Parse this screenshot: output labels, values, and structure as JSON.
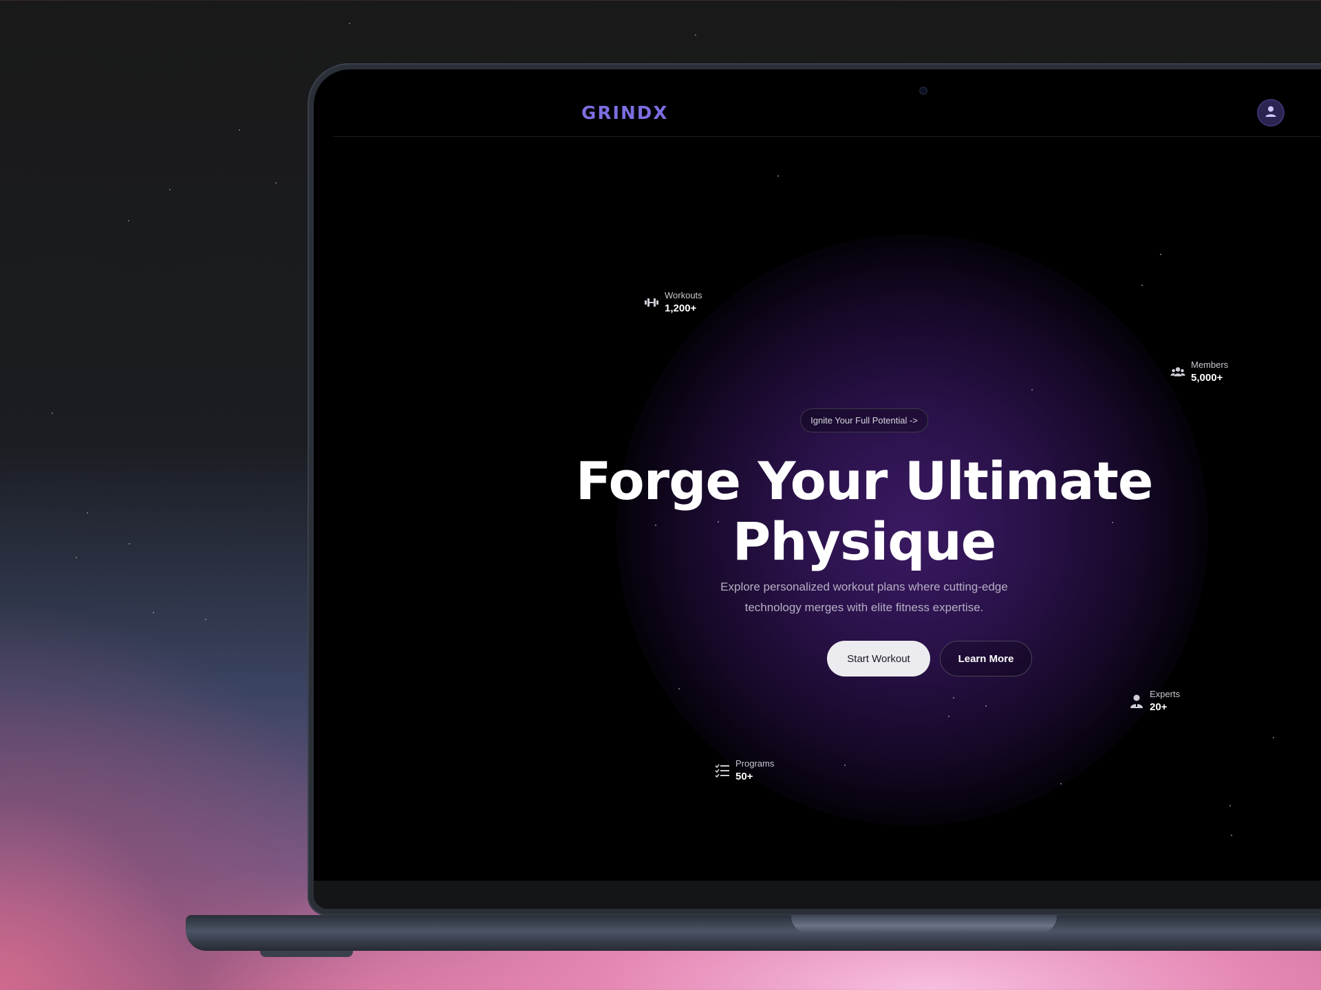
{
  "brand": {
    "name": "GRINDX"
  },
  "header": {
    "profile_icon": "user-icon"
  },
  "hero": {
    "badge": "Ignite Your Full Potential ->",
    "title": "Forge Your Ultimate Physique",
    "subtitle": "Explore personalized workout plans where cutting-edge technology merges with elite fitness expertise.",
    "primary_cta": "Start Workout",
    "secondary_cta": "Learn More"
  },
  "stats": [
    {
      "label": "Workouts",
      "value": "1,200+",
      "icon": "dumbbell-icon"
    },
    {
      "label": "Members",
      "value": "5,000+",
      "icon": "users-icon"
    },
    {
      "label": "Experts",
      "value": "20+",
      "icon": "expert-icon"
    },
    {
      "label": "Programs",
      "value": "50+",
      "icon": "checklist-icon"
    }
  ],
  "colors": {
    "brand": "#7b6ee0",
    "primary_button_bg": "#ececf0",
    "glow": "#3a1962"
  }
}
